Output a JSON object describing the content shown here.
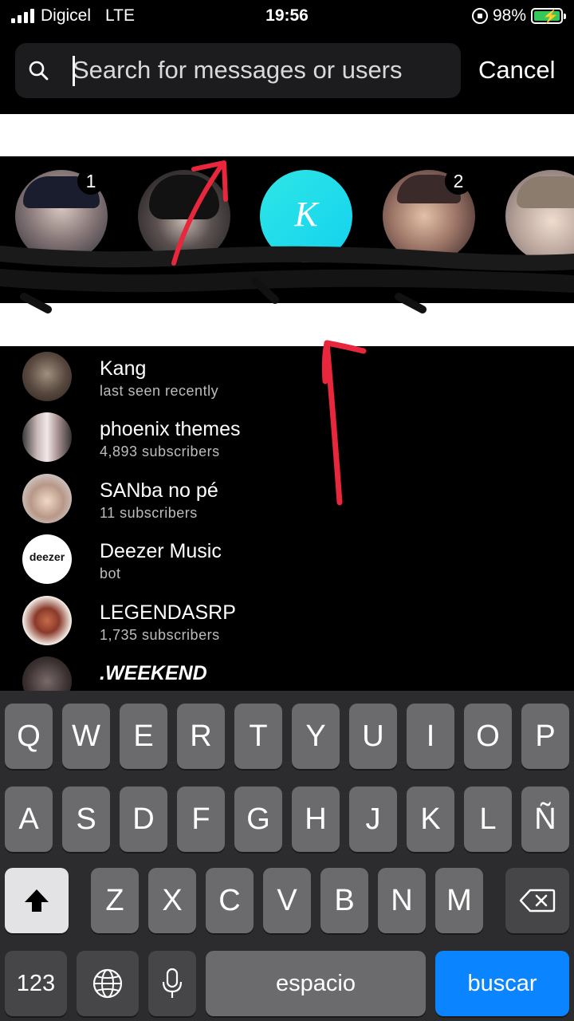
{
  "status_bar": {
    "carrier": "Digicel",
    "network": "LTE",
    "time": "19:56",
    "battery_percent": "98%",
    "battery_level": 0.98,
    "signal_bars": 4
  },
  "search": {
    "placeholder": "Search for messages or users",
    "cancel_label": "Cancel"
  },
  "stories": [
    {
      "badge": "1",
      "icon": "avatar-photo"
    },
    {
      "badge": "",
      "icon": "avatar-photo"
    },
    {
      "badge": "",
      "initial": "K",
      "color": "#1fdcee"
    },
    {
      "badge": "2",
      "icon": "avatar-photo"
    },
    {
      "badge": "",
      "icon": "avatar-photo"
    }
  ],
  "chats": [
    {
      "name": "Kang",
      "subtitle": "last seen recently"
    },
    {
      "name": "phoenix themes",
      "subtitle": "4,893 subscribers"
    },
    {
      "name": "SANba no pé",
      "subtitle": "11 subscribers"
    },
    {
      "name": "Deezer Music",
      "subtitle": "bot",
      "avatar_text": "deezer"
    },
    {
      "name": "LEGENDASRP",
      "subtitle": "1,735 subscribers"
    },
    {
      "name": ".WEEKEND",
      "subtitle": ""
    }
  ],
  "keyboard": {
    "row1": [
      "Q",
      "W",
      "E",
      "R",
      "T",
      "Y",
      "U",
      "I",
      "O",
      "P"
    ],
    "row2": [
      "A",
      "S",
      "D",
      "F",
      "G",
      "H",
      "J",
      "K",
      "L",
      "Ñ"
    ],
    "row3": [
      "Z",
      "X",
      "C",
      "V",
      "B",
      "N",
      "M"
    ],
    "numbers_label": "123",
    "space_label": "espacio",
    "action_label": "buscar",
    "shift_icon": "shift-arrow-icon",
    "globe_icon": "globe-icon",
    "mic_icon": "microphone-icon",
    "delete_icon": "backspace-icon"
  },
  "colors": {
    "accent_blue": "#0a84ff",
    "annotation_red": "#e8263c",
    "battery_green": "#34c759"
  }
}
